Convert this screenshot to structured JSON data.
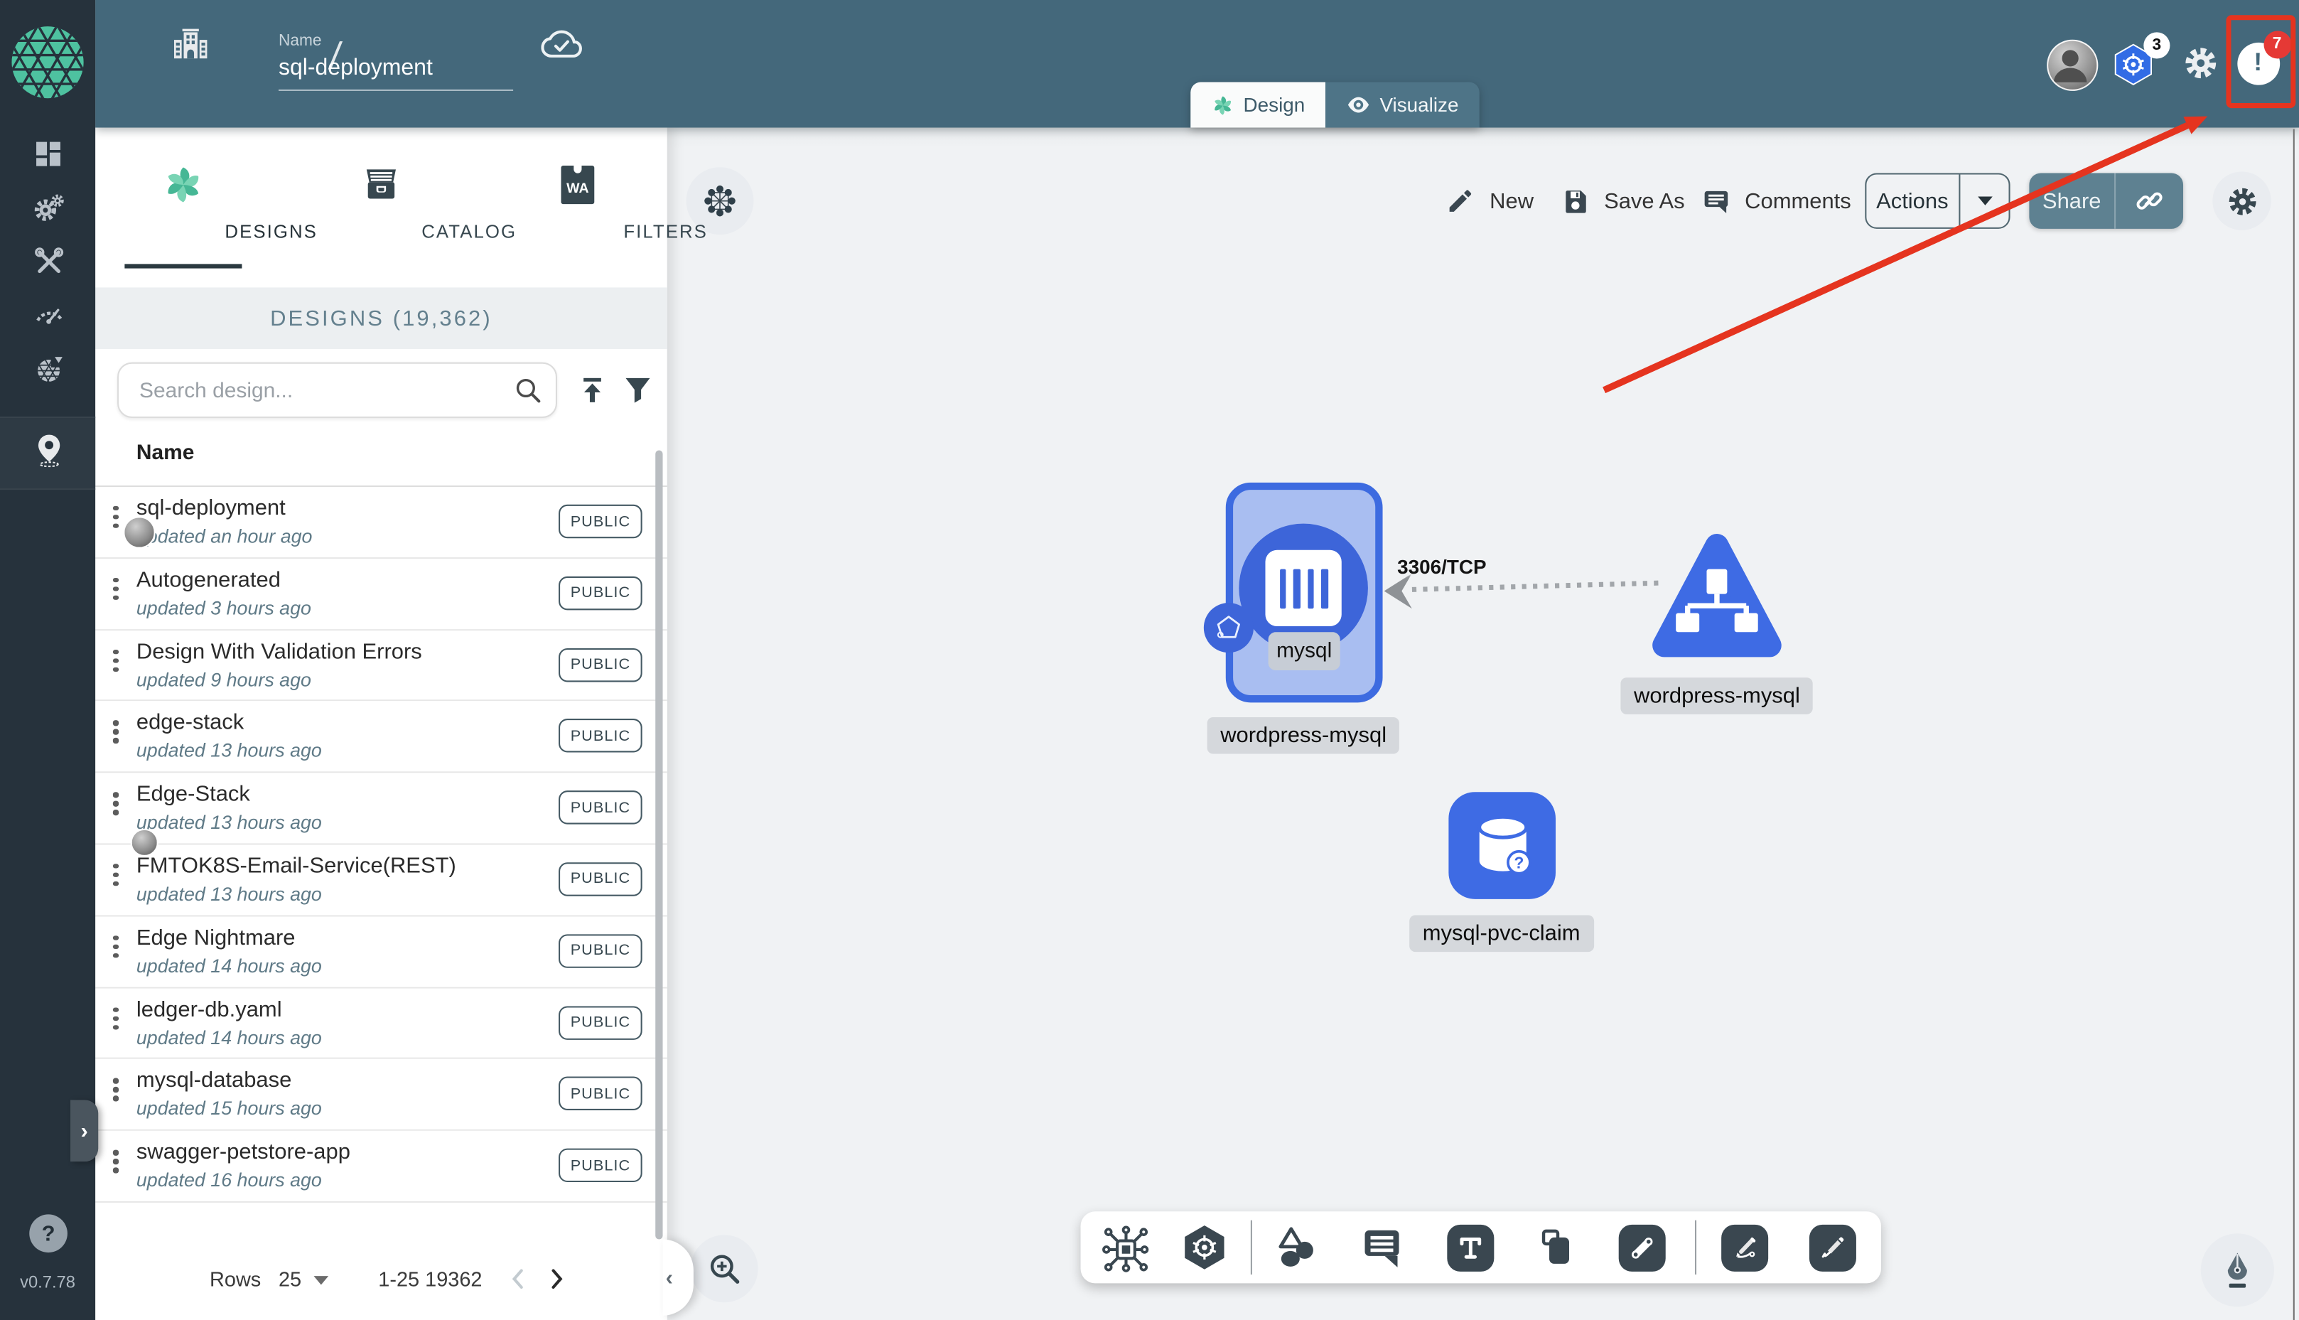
{
  "app": {
    "version": "v0.7.78"
  },
  "header": {
    "name_label": "Name",
    "design_name": "sql-deployment",
    "kubernetes_context_count": "3",
    "notification_count": "7"
  },
  "mode_tabs": [
    {
      "label": "Design",
      "active": true
    },
    {
      "label": "Visualize",
      "active": false
    }
  ],
  "canvas_toolbar": {
    "new_label": "New",
    "save_as_label": "Save As",
    "comments_label": "Comments",
    "actions_label": "Actions",
    "share_label": "Share"
  },
  "left_panel": {
    "tabs": [
      {
        "label": "DESIGNS",
        "active": true
      },
      {
        "label": "CATALOG",
        "active": false
      },
      {
        "label": "FILTERS",
        "active": false
      }
    ],
    "section_title": "DESIGNS (19,362)",
    "search_placeholder": "Search design...",
    "table_header": "Name",
    "designs": [
      {
        "name": "sql-deployment",
        "updated": "updated an hour ago",
        "visibility": "PUBLIC",
        "menu": true,
        "avatar": "inline"
      },
      {
        "name": "Autogenerated",
        "updated": "updated 3 hours ago",
        "visibility": "PUBLIC"
      },
      {
        "name": "Design With Validation Errors",
        "updated": "updated 9 hours ago",
        "visibility": "PUBLIC"
      },
      {
        "name": "edge-stack",
        "updated": "updated 13 hours ago",
        "visibility": "PUBLIC"
      },
      {
        "name": "Edge-Stack",
        "updated": "updated 13 hours ago",
        "visibility": "PUBLIC",
        "avatar": "bottom"
      },
      {
        "name": "FMTOK8S-Email-Service(REST)",
        "updated": "updated 13 hours ago",
        "visibility": "PUBLIC"
      },
      {
        "name": "Edge Nightmare",
        "updated": "updated 14 hours ago",
        "visibility": "PUBLIC"
      },
      {
        "name": "ledger-db.yaml",
        "updated": "updated 14 hours ago",
        "visibility": "PUBLIC"
      },
      {
        "name": "mysql-database",
        "updated": "updated 15 hours ago",
        "visibility": "PUBLIC"
      },
      {
        "name": "swagger-petstore-app",
        "updated": "updated 16 hours ago",
        "visibility": "PUBLIC"
      }
    ],
    "pagination": {
      "rows_label": "Rows",
      "per_page": "25",
      "range": "1-25 19362"
    }
  },
  "canvas": {
    "edge": {
      "label": "3306/TCP"
    },
    "nodes": {
      "deployment": {
        "inner_label": "mysql",
        "label": "wordpress-mysql"
      },
      "service": {
        "label": "wordpress-mysql"
      },
      "pvc": {
        "label": "mysql-pvc-claim"
      }
    }
  },
  "colors": {
    "header_teal": "#44687B",
    "sidebar_dark": "#26323C",
    "brand_green": "#4EC2A0",
    "node_blue": "#3E6BE4",
    "node_fill": "#A9BEF1",
    "kubernetes_blue": "#326CE5",
    "annotation_red": "#E5341F",
    "share_button": "#5E8191"
  }
}
